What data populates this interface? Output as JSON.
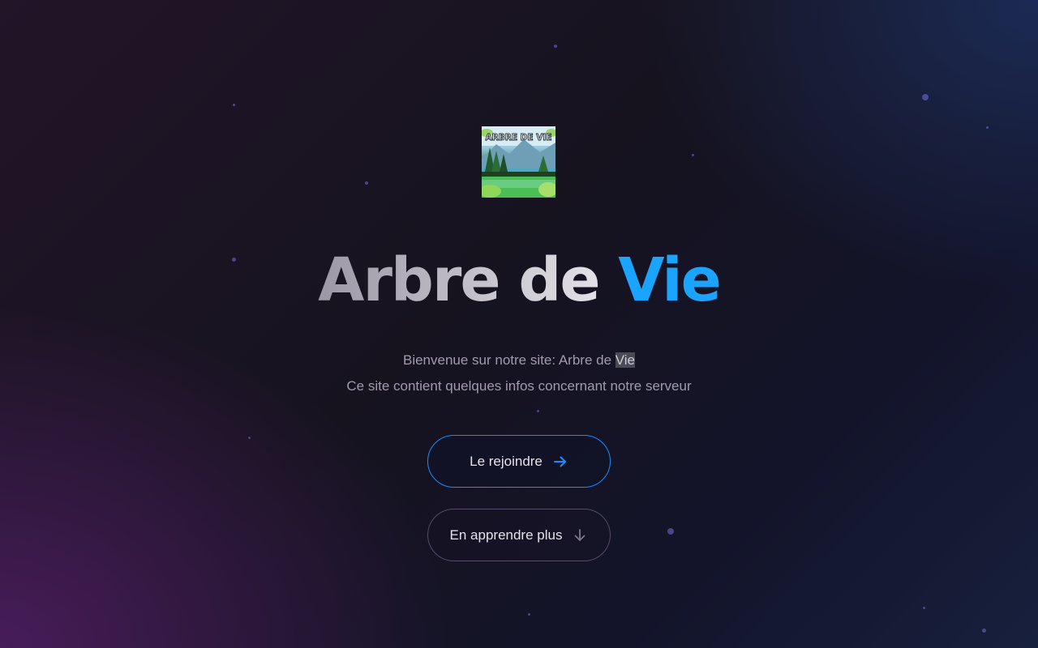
{
  "logo": {
    "text": "ARBRE DE VIE"
  },
  "hero": {
    "title_main": "Arbre de ",
    "title_accent": "Vie"
  },
  "intro": {
    "line1_prefix": "Bienvenue sur notre site: Arbre de ",
    "line1_highlight": "Vie",
    "line2": "Ce site contient quelques infos concernant notre serveur"
  },
  "buttons": {
    "join_label": "Le rejoindre",
    "join_icon": "arrow-right-icon",
    "more_label": "En apprendre plus",
    "more_icon": "arrow-down-icon"
  },
  "colors": {
    "accent": "#1aa3ff",
    "button_border": "#1a8cff"
  }
}
